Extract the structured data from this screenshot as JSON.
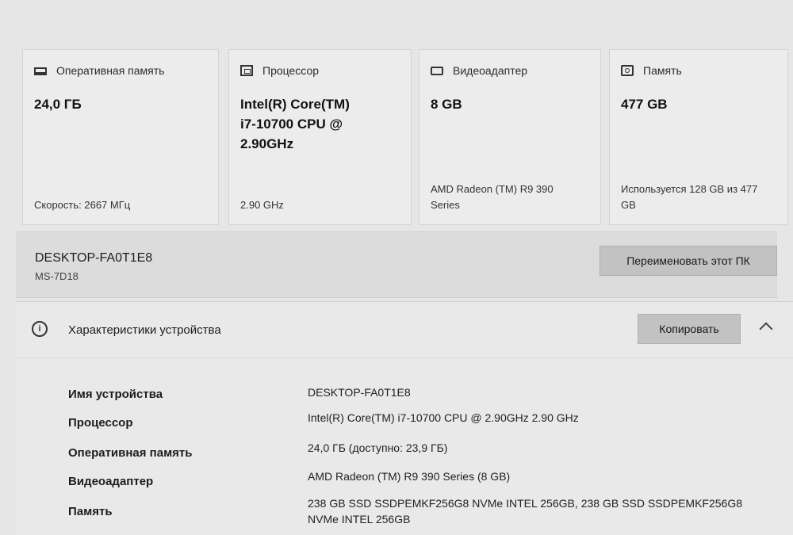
{
  "cards": [
    {
      "icon": "memory-icon",
      "title": "Оперативная память",
      "value": "24,0 ГБ",
      "footer": "Скорость: 2667 МГц"
    },
    {
      "icon": "processor-icon",
      "title": "Процессор",
      "value": "Intel(R) Core(TM)\ni7-10700 CPU @\n2.90GHz",
      "footer": "2.90 GHz"
    },
    {
      "icon": "display-adapter-icon",
      "title": "Видеоадаптер",
      "value": "8 GB",
      "footer": "AMD Radeon (TM) R9 390\nSeries"
    },
    {
      "icon": "storage-icon",
      "title": "Память",
      "value": "477 GB",
      "footer": "Используется 128 GB из 477\nGB"
    }
  ],
  "pc": {
    "name": "DESKTOP-FA0T1E8",
    "model": "MS-7D18",
    "rename_label": "Переименовать этот ПК"
  },
  "spec": {
    "title": "Характеристики устройства",
    "copy_label": "Копировать",
    "rows": [
      {
        "key": "Имя устройства",
        "value": "DESKTOP-FA0T1E8"
      },
      {
        "key": "Процессор",
        "value": "Intel(R) Core(TM) i7-10700 CPU @ 2.90GHz   2.90 GHz"
      },
      {
        "key": "Оперативная память",
        "value": "24,0 ГБ (доступно: 23,9 ГБ)"
      },
      {
        "key": "Видеоадаптер",
        "value": "AMD Radeon (TM) R9 390 Series (8 GB)"
      },
      {
        "key": "Память",
        "value": "238 GB SSD SSDPEMKF256G8 NVMe INTEL 256GB, 238 GB SSD SSDPEMKF256G8 NVMe INTEL 256GB"
      }
    ]
  }
}
